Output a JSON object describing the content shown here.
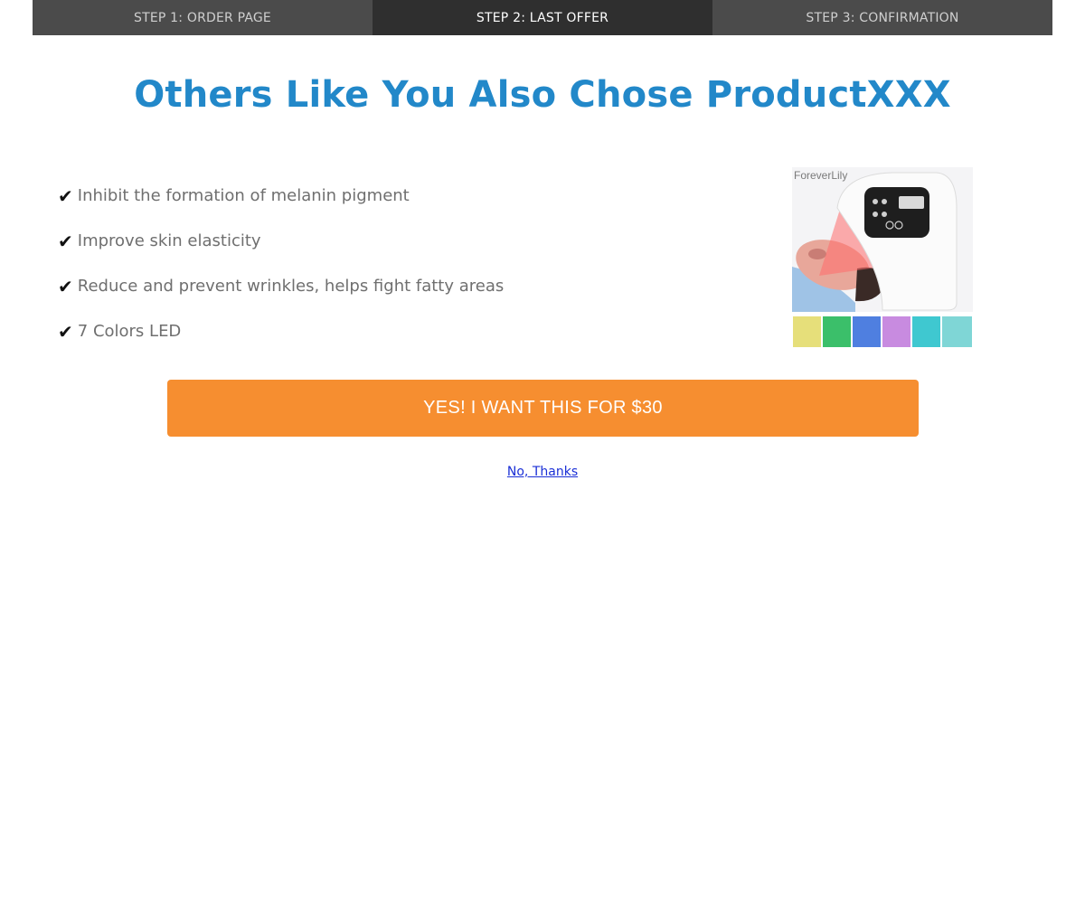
{
  "steps": [
    {
      "label": "STEP 1: ORDER PAGE",
      "active": false
    },
    {
      "label": "STEP 2: LAST OFFER",
      "active": true
    },
    {
      "label": "STEP 3: CONFIRMATION",
      "active": false
    }
  ],
  "headline": "Others Like You Also Chose ProductXXX",
  "benefits": [
    {
      "check": "✔",
      "text": "Inhibit the formation of melanin pigment"
    },
    {
      "check": "✔",
      "text": "Improve skin elasticity"
    },
    {
      "check": "✔",
      "text": "Reduce and prevent wrinkles, helps fight fatty areas"
    },
    {
      "check": "✔",
      "text": "7 Colors LED"
    }
  ],
  "product_image": {
    "brand_text": "ForeverLily",
    "swatch_colors": [
      "#e6df7a",
      "#3bbf6a",
      "#4f7fe0",
      "#c88be0",
      "#3fc8d0",
      "#7fd6d6"
    ]
  },
  "cta": {
    "label": "YES! I WANT THIS FOR $30"
  },
  "decline": {
    "label": "No, Thanks"
  },
  "colors": {
    "headline": "#2288c9",
    "cta_bg": "#f68e30",
    "step_bg": "#4b4b4b",
    "step_active_bg": "#2f2f2f",
    "link": "#1a2fd6"
  }
}
